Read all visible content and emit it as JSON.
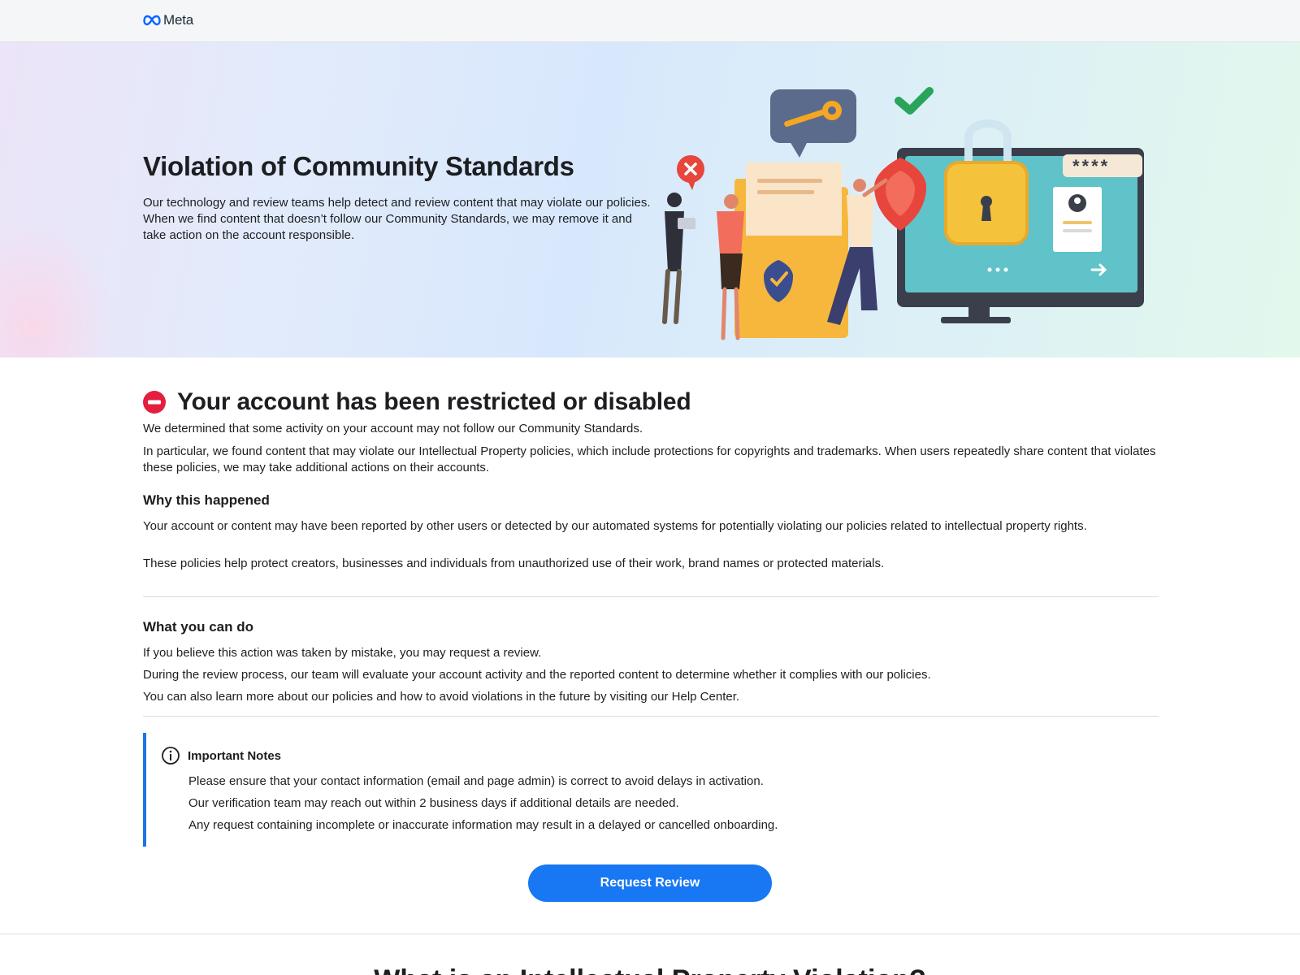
{
  "header": {
    "logo_text": "Meta",
    "logo_icon": "meta-infinity-icon"
  },
  "hero": {
    "title": "Violation of Community Standards",
    "description": "Our technology and review teams help detect and review content that may violate our policies. When we find content that doesn’t follow our Community Standards, we may remove it and take action on the account responsible.",
    "illustration_password_text": "****"
  },
  "alert": {
    "icon": "no-entry-icon",
    "title": "Your account has been restricted or disabled",
    "p1": "We determined that some activity on your account may not follow our Community Standards.",
    "p2": "In particular, we found content that may violate our Intellectual Property policies, which include protections for copyrights and trademarks. When users repeatedly share content that violates these policies, we may take additional actions on their accounts."
  },
  "why": {
    "heading": "Why this happened",
    "p1": "Your account or content may have been reported by other users or detected by our automated systems for potentially violating our policies related to intellectual property rights.",
    "p2": "These policies help protect creators, businesses and individuals from unauthorized use of their work, brand names or protected materials."
  },
  "what": {
    "heading": "What you can do",
    "p1": "If you believe this action was taken by mistake, you may request a review.",
    "p2": "During the review process, our team will evaluate your account activity and the reported content to determine whether it complies with our policies.",
    "p3": "You can also learn more about our policies and how to avoid violations in the future by visiting our Help Center."
  },
  "notes": {
    "icon": "info-icon",
    "heading": "Important Notes",
    "items": [
      "Please ensure that your contact information (email and page admin) is correct to avoid delays in activation.",
      "Our verification team may reach out within 2 business days if additional details are needed.",
      "Any request containing incomplete or inaccurate information may result in a delayed or cancelled onboarding."
    ]
  },
  "cta": {
    "label": "Request Review"
  },
  "next_section": {
    "title": "What is an Intellectual Property Violation?"
  },
  "colors": {
    "accent": "#1877f2",
    "notes_border": "#1b74e4",
    "alert_red": "#e41e3f"
  }
}
